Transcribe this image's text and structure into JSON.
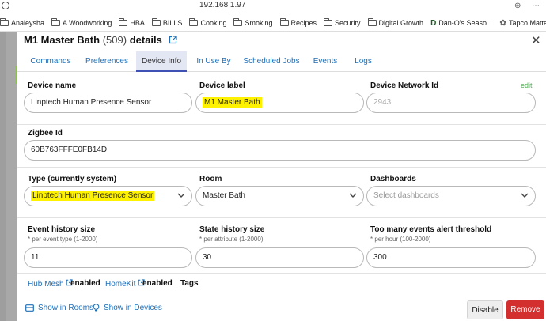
{
  "browser": {
    "address": "192.168.1.97",
    "bookmarks": [
      {
        "label": "Analeysha",
        "icon": "folder-icon"
      },
      {
        "label": "A Woodworking",
        "icon": "folder-icon"
      },
      {
        "label": "HBA",
        "icon": "folder-icon"
      },
      {
        "label": "BILLS",
        "icon": "folder-icon"
      },
      {
        "label": "Cooking",
        "icon": "folder-icon"
      },
      {
        "label": "Smoking",
        "icon": "folder-icon"
      },
      {
        "label": "Recipes",
        "icon": "folder-icon"
      },
      {
        "label": "Security",
        "icon": "folder-icon"
      },
      {
        "label": "Digital Growth",
        "icon": "folder-icon"
      },
      {
        "label": "Dan-O's Seaso...",
        "icon": "dano-icon"
      },
      {
        "label": "Tapco Matter D...",
        "icon": "gear-icon"
      }
    ]
  },
  "modal": {
    "title": "M1 Master Bath",
    "count": "(509)",
    "title_suffix": "details",
    "tabs": [
      "Commands",
      "Preferences",
      "Device Info",
      "In Use By",
      "Scheduled Jobs",
      "Events",
      "Logs"
    ],
    "active_tab": "Device Info",
    "device_name": {
      "label": "Device name",
      "value": "Linptech Human Presence Sensor"
    },
    "device_label": {
      "label": "Device label",
      "value": "M1 Master Bath"
    },
    "network_id": {
      "label": "Device Network Id",
      "value": "2943",
      "edit": "edit"
    },
    "zigbee_id": {
      "label": "Zigbee Id",
      "value": "60B763FFFE0FB14D"
    },
    "type": {
      "label": "Type (currently system)",
      "value": "Linptech Human Presence Sensor"
    },
    "room": {
      "label": "Room",
      "value": "Master Bath"
    },
    "dashboards": {
      "label": "Dashboards",
      "placeholder": "Select dashboards"
    },
    "event_history": {
      "label": "Event history size",
      "hint": "* per event type (1-2000)",
      "value": "11"
    },
    "state_history": {
      "label": "State history size",
      "hint": "* per attribute (1-2000)",
      "value": "30"
    },
    "too_many_events": {
      "label": "Too many events alert threshold",
      "hint": "* per hour (100-2000)",
      "value": "300"
    },
    "hub_mesh": {
      "label": "Hub Mesh",
      "status": "enabled"
    },
    "homekit": {
      "label": "HomeKit",
      "status": "enabled"
    },
    "tags_label": "Tags",
    "footer": {
      "show_in_rooms": "Show in Rooms",
      "show_in_devices": "Show in Devices",
      "disable": "Disable",
      "remove": "Remove"
    },
    "colors": {
      "accent": "#1e6fb8",
      "highlight": "#fff200",
      "remove": "#d32f2f",
      "edit": "#4caf50"
    }
  }
}
